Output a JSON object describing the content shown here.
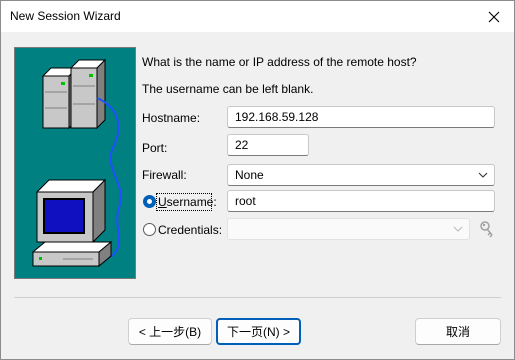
{
  "window": {
    "title": "New Session Wizard",
    "close_icon": "close-icon"
  },
  "colors": {
    "accent": "#005fb8",
    "illustration_bg": "#008080"
  },
  "prompt": {
    "line1": "What is the name or IP address of the remote host?",
    "line2": "The username can be left blank."
  },
  "form": {
    "hostname_label": "Hostname:",
    "hostname_value": "192.168.59.128",
    "port_label": "Port:",
    "port_value": "22",
    "firewall_label": "Firewall:",
    "firewall_value": "None",
    "username_label": "Username:",
    "username_value": "root",
    "username_selected": true,
    "credentials_label": "Credentials:",
    "credentials_value": "",
    "credentials_selected": false,
    "key_icon": "key-icon"
  },
  "buttons": {
    "back_label": "< 上一步(B)",
    "next_label": "下一页(N) >",
    "cancel_label": "取消"
  }
}
